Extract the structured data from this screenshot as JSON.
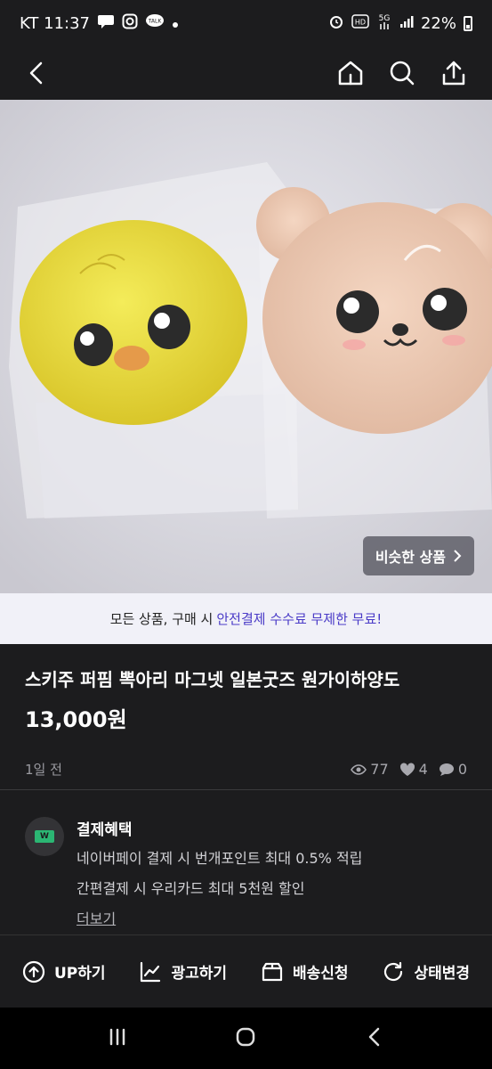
{
  "status": {
    "carrier_time": "KT 11:37",
    "battery": "22%",
    "badges": [
      "talk-icon",
      "instagram-icon",
      "alarm-icon",
      "hd-icon",
      "5g-icon",
      "signal-icon"
    ]
  },
  "header": {
    "back": "back-arrow-icon",
    "home": "home-icon",
    "search": "search-icon",
    "share": "share-icon"
  },
  "product_image": {
    "similar_button": "비슷한 상품"
  },
  "promo": {
    "prefix": "모든 상품, 구매 시",
    "highlight": "안전결제 수수료 무제한 무료!"
  },
  "product": {
    "title": "스키주 퍼핌 뽁아리 마그넷 일본굿즈 원가이하양도",
    "price": "13,000원",
    "posted": "1일 전",
    "views": "77",
    "likes": "4",
    "chats": "0"
  },
  "benefit": {
    "title": "결제혜택",
    "line1": "네이버페이 결제 시 번개포인트 최대 0.5% 적립",
    "line2": "간편결제 시 우리카드 최대 5천원 할인",
    "more": "더보기"
  },
  "actions": {
    "up": "UP하기",
    "ad": "광고하기",
    "shipping": "배송신청",
    "status_change": "상태변경"
  },
  "colors": {
    "background": "#1c1c1e",
    "accent": "#4a3bc7",
    "promo_bg": "#f1f1f8"
  }
}
